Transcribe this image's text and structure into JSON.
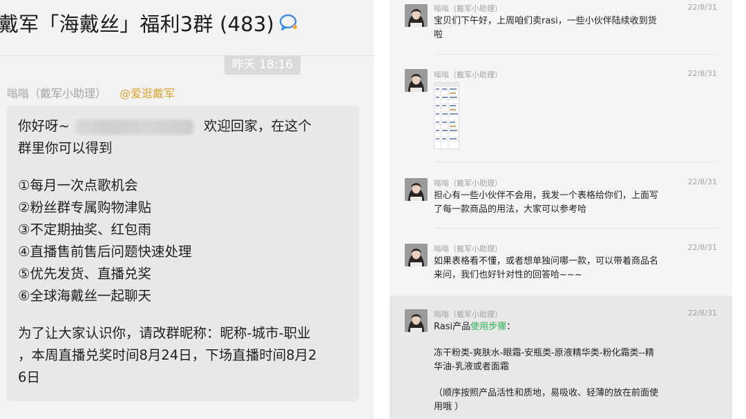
{
  "left_chat": {
    "title": "戴军「海戴丝」福利3群 (483)",
    "group_icon": "chat-bubble-icon",
    "time_divider": "昨天 18:16",
    "sender": "嗡嗡（戴军小助理）",
    "mention": "@爱逛戴军",
    "message": {
      "greeting_prefix": "你好呀~",
      "greeting_suffix": "欢迎回家，在这个",
      "line2": "群里你可以得到",
      "benefits": [
        "①每月一次点歌机会",
        "②粉丝群专属购物津贴",
        "③不定期抽奖、红包雨",
        "④直播售前售后问题快速处理",
        "⑤优先发货、直播兑奖",
        "⑥全球海戴丝一起聊天"
      ],
      "closing_lines": [
        "为了让大家认识你，请改群昵称：昵称-城市-职业",
        "，本周直播兑奖时间8月24日，下场直播时间8月2",
        "6日"
      ]
    }
  },
  "history": {
    "items": [
      {
        "sender": "嗡嗡（戴军小助理）",
        "date": "22/8/31",
        "lines": [
          "宝贝们下午好，上周咱们卖rasi，一些小伙伴陆续收到货",
          "啦"
        ]
      },
      {
        "sender": "嗡嗡（戴军小助理）",
        "date": "22/8/31",
        "image": "spreadsheet-thumbnail"
      },
      {
        "sender": "嗡嗡（戴军小助理）",
        "date": "22/8/31",
        "lines": [
          "担心有一些小伙伴不会用，我发一个表格给你们，上面写",
          "了每一款商品的用法，大家可以参考哈"
        ]
      },
      {
        "sender": "嗡嗡（戴军小助理）",
        "date": "22/8/31",
        "lines": [
          "如果表格看不懂，或者想单独问哪一款，可以带着商品名",
          "来问，我们也好针对性的回答哈~~~"
        ]
      },
      {
        "sender": "嗡嗡（戴军小助理）",
        "date": "22/8/31",
        "first_plain": "Rasi产品",
        "first_link": "使用步骤",
        "first_tail": "：",
        "lines": [
          "冻干粉类-爽肤水-眼霜-安瓶类-原液精华类-粉化霜类--精",
          "华油-乳液或者面霜",
          "（顺序按照产品活性和质地，易吸收、轻薄的放在前面使",
          "用哦 ）"
        ]
      }
    ]
  },
  "colors": {
    "link_green": "#29b350",
    "mention_gold": "#d9a634",
    "bubble_bg": "#e8e8e8"
  }
}
